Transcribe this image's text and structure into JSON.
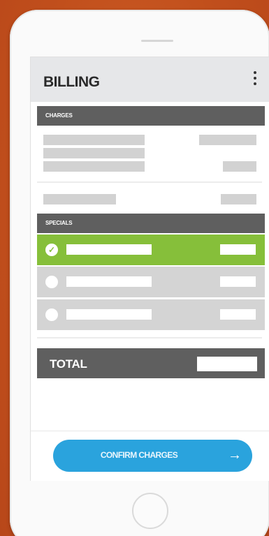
{
  "app": {
    "title": "BILLING"
  },
  "charges": {
    "section_label": "CHARGES"
  },
  "specials": {
    "section_label": "SPECIALS",
    "items": [
      {
        "selected": true
      },
      {
        "selected": false
      },
      {
        "selected": false
      }
    ]
  },
  "total": {
    "label": "TOTAL"
  },
  "confirm": {
    "label": "CONFIRM CHARGES",
    "icon": "arrow-right-icon"
  },
  "colors": {
    "background": "#c4531f",
    "header_bg": "#e6e7e9",
    "section_bar": "#5f5f5f",
    "selected_row": "#86bf3a",
    "unselected_row": "#d4d4d4",
    "placeholder": "#d2d2d2",
    "confirm_button": "#2aa3dd"
  },
  "icons": {
    "menu": "kebab-menu-icon",
    "check": "checkmark-icon"
  }
}
